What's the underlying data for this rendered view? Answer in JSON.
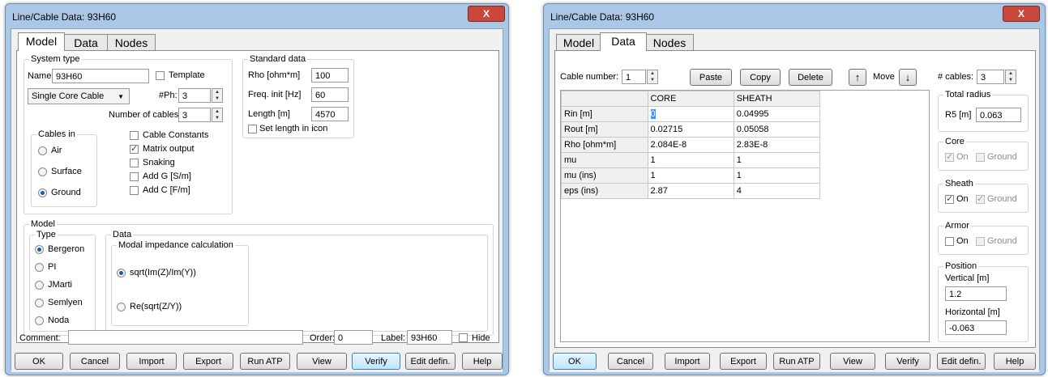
{
  "left": {
    "title": "Line/Cable Data: 93H60",
    "close": "X",
    "tabs": [
      "Model",
      "Data",
      "Nodes"
    ],
    "system_type": {
      "label": "System type",
      "name_label": "Name:",
      "name_value": "93H60",
      "template": "Template",
      "cable_type": "Single Core Cable",
      "nph_label": "#Ph:",
      "nph_value": "3",
      "num_cables_label": "Number of cables:",
      "num_cables_value": "3",
      "cables_in": "Cables in",
      "radios": [
        "Air",
        "Surface",
        "Ground"
      ],
      "checks": [
        "Cable Constants",
        "Matrix output",
        "Snaking",
        "Add G [S/m]",
        "Add C [F/m]"
      ]
    },
    "standard": {
      "label": "Standard data",
      "rho_label": "Rho [ohm*m]",
      "rho_value": "100",
      "freq_label": "Freq. init [Hz]",
      "freq_value": "60",
      "length_label": "Length [m]",
      "length_value": "4570",
      "set_length": "Set length in icon"
    },
    "model": {
      "label": "Model",
      "type_label": "Type",
      "types": [
        "Bergeron",
        "PI",
        "JMarti",
        "Semlyen",
        "Noda"
      ],
      "data_label": "Data",
      "modal_label": "Modal impedance calculation",
      "opt1": "sqrt(Im(Z)/Im(Y))",
      "opt2": "Re(sqrt(Z/Y))"
    },
    "comment_label": "Comment:",
    "order_label": "Order:",
    "order_value": "0",
    "label_label": "Label:",
    "label_value": "93H60",
    "hide": "Hide",
    "buttons": [
      "OK",
      "Cancel",
      "Import",
      "Export",
      "Run ATP",
      "View",
      "Verify",
      "Edit defin.",
      "Help"
    ]
  },
  "right": {
    "title": "Line/Cable Data: 93H60",
    "close": "X",
    "tabs": [
      "Model",
      "Data",
      "Nodes"
    ],
    "cable_number_label": "Cable number:",
    "cable_number_value": "1",
    "paste": "Paste",
    "copy": "Copy",
    "delete": "Delete",
    "move": "Move",
    "up_arrow": "↑",
    "down_arrow": "↓",
    "ncables_label": "# cables:",
    "ncables_value": "3",
    "table": {
      "columns": [
        "",
        "CORE",
        "SHEATH"
      ],
      "rows": [
        [
          "Rin [m]",
          "0",
          "0.04995"
        ],
        [
          "Rout [m]",
          "0.02715",
          "0.05058"
        ],
        [
          "Rho [ohm*m]",
          "2.084E-8",
          "2.83E-8"
        ],
        [
          "mu",
          "1",
          "1"
        ],
        [
          "mu (ins)",
          "1",
          "1"
        ],
        [
          "eps (ins)",
          "2.87",
          "4"
        ]
      ]
    },
    "total_radius_label": "Total radius",
    "r5_label": "R5 [m]",
    "r5_value": "0.063",
    "core_label": "Core",
    "sheath_label": "Sheath",
    "armor_label": "Armor",
    "on": "On",
    "ground": "Ground",
    "position_label": "Position",
    "vertical_label": "Vertical [m]",
    "vertical_value": "1.2",
    "horizontal_label": "Horizontal [m]",
    "horizontal_value": "-0.063",
    "buttons": [
      "OK",
      "Cancel",
      "Import",
      "Export",
      "Run ATP",
      "View",
      "Verify",
      "Edit defin.",
      "Help"
    ]
  }
}
